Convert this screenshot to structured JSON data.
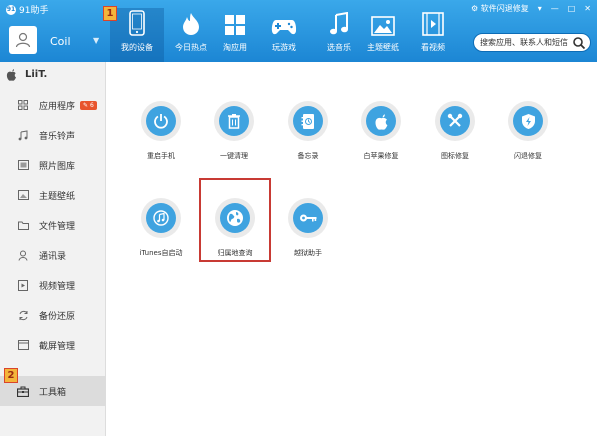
{
  "app": {
    "title": "91助手"
  },
  "account": {
    "username": "Coil"
  },
  "nav": {
    "items": [
      {
        "label": "我的设备",
        "icon": "phone-icon"
      },
      {
        "label": "今日热点",
        "icon": "flame-icon"
      },
      {
        "label": "淘应用",
        "icon": "apps-grid-icon"
      },
      {
        "label": "玩游戏",
        "icon": "gamepad-icon"
      },
      {
        "label": "选音乐",
        "icon": "music-note-icon"
      },
      {
        "label": "主题壁纸",
        "icon": "picture-icon"
      },
      {
        "label": "看视频",
        "icon": "film-icon"
      }
    ],
    "active_index": 0
  },
  "window": {
    "flash_repair": "软件闪退修复",
    "controls": [
      "▾",
      "—",
      "□",
      "✕"
    ]
  },
  "search": {
    "placeholder": "搜索应用、联系人和短信"
  },
  "annotations": {
    "nav_marker": "1",
    "sidebar_marker": "2"
  },
  "device": {
    "name": "LiiT."
  },
  "sidebar": {
    "items": [
      {
        "label": "应用程序",
        "icon": "apps-icon",
        "badge": "✎ 6"
      },
      {
        "label": "音乐铃声",
        "icon": "music-icon"
      },
      {
        "label": "照片图库",
        "icon": "photo-icon"
      },
      {
        "label": "主题壁纸",
        "icon": "wallpaper-icon"
      },
      {
        "label": "文件管理",
        "icon": "folder-icon"
      },
      {
        "label": "通讯录",
        "icon": "contacts-icon"
      },
      {
        "label": "视频管理",
        "icon": "video-icon"
      },
      {
        "label": "备份还原",
        "icon": "backup-icon"
      },
      {
        "label": "截屏管理",
        "icon": "screenshot-icon"
      },
      {
        "label": "工具箱",
        "icon": "toolbox-icon"
      }
    ],
    "active_index": 9
  },
  "tools": [
    {
      "label": "重启手机",
      "icon": "power-icon"
    },
    {
      "label": "一键清理",
      "icon": "trash-icon"
    },
    {
      "label": "备忘录",
      "icon": "memo-icon"
    },
    {
      "label": "白苹果修复",
      "icon": "apple-icon"
    },
    {
      "label": "图标修复",
      "icon": "wrench-icon"
    },
    {
      "label": "闪退修复",
      "icon": "shield-icon"
    },
    {
      "label": "iTunes自启动",
      "icon": "itunes-icon"
    },
    {
      "label": "归属地查询",
      "icon": "globe-icon"
    },
    {
      "label": "越狱助手",
      "icon": "key-icon"
    }
  ],
  "colors": {
    "topbar": "#1c86d4",
    "tool_icon": "#3fa3e0",
    "tile_bg": "#eaeaea",
    "highlight_border": "#c83a34",
    "marker_fill": "#f4b53a"
  }
}
